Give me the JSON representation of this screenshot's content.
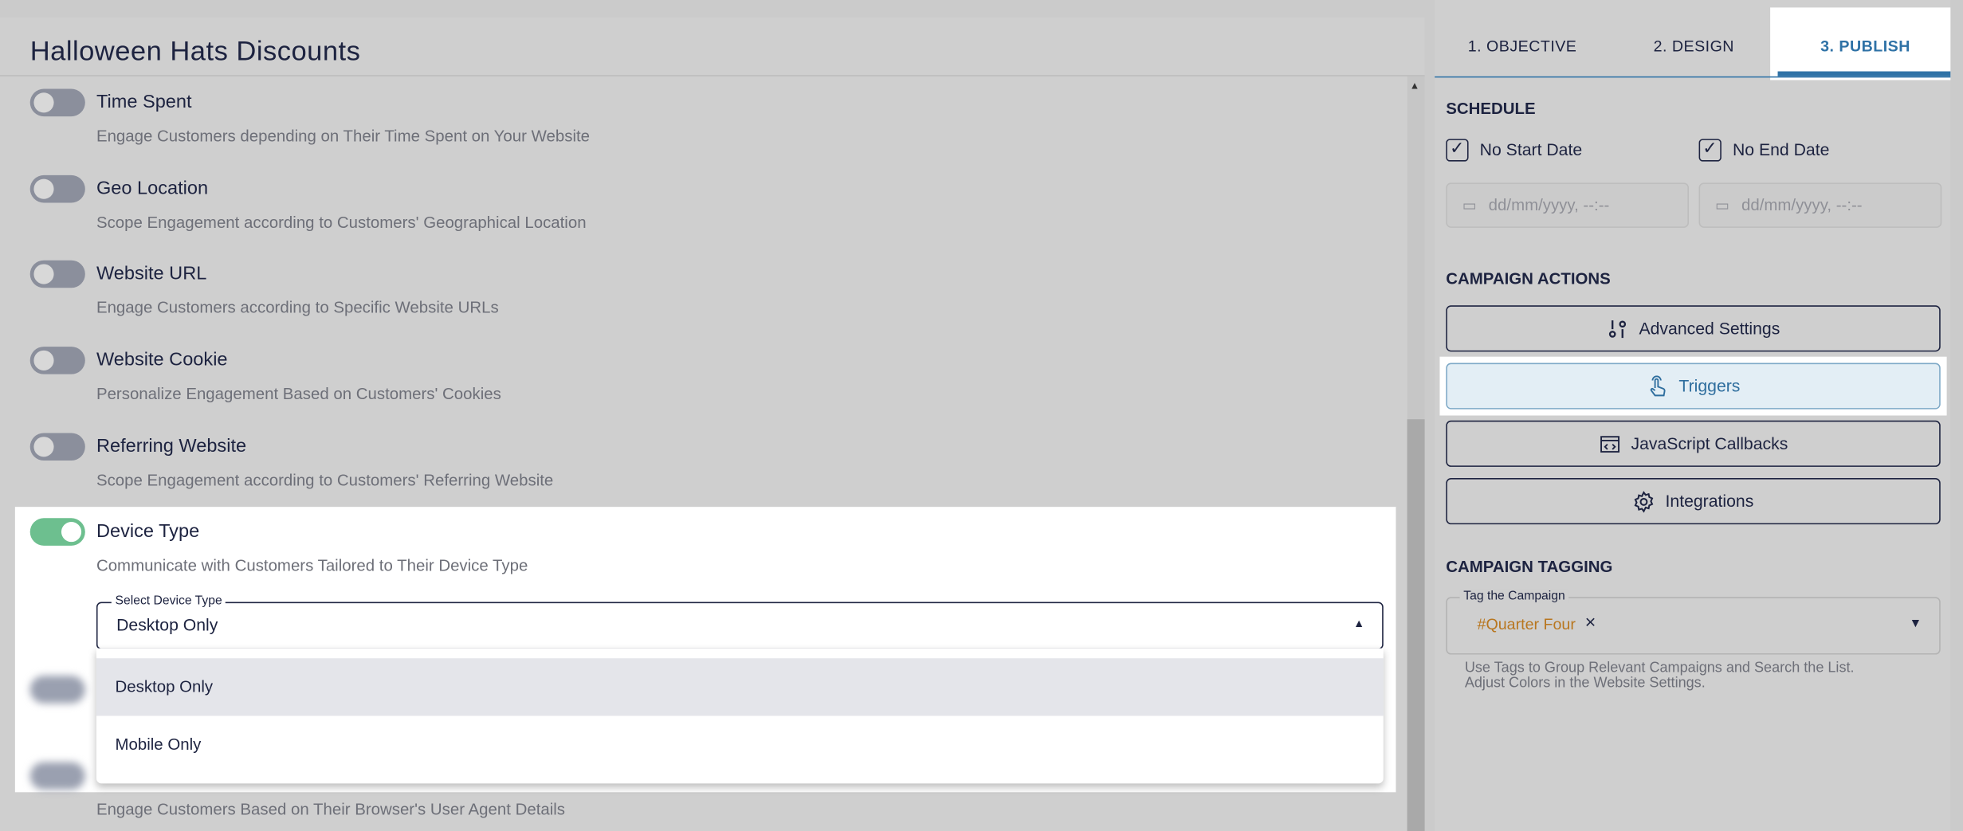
{
  "page_title": "Halloween Hats Discounts",
  "rules": [
    {
      "title": "Time Spent",
      "description": "Engage Customers depending on Their Time Spent on Your Website",
      "enabled": false
    },
    {
      "title": "Geo Location",
      "description": "Scope Engagement according to Customers' Geographical Location",
      "enabled": false
    },
    {
      "title": "Website URL",
      "description": "Engage Customers according to Specific Website URLs",
      "enabled": false
    },
    {
      "title": "Website Cookie",
      "description": "Personalize Engagement Based on Customers' Cookies",
      "enabled": false
    },
    {
      "title": "Referring Website",
      "description": "Scope Engagement according to Customers' Referring Website",
      "enabled": false
    },
    {
      "title": "Device Type",
      "description": "Communicate with Customers Tailored to Their Device Type",
      "enabled": true
    },
    {
      "description": "Engage Customers Based on Their Browser's User Agent Details",
      "enabled": false
    }
  ],
  "device_select": {
    "label": "Select Device Type",
    "value": "Desktop Only",
    "options": [
      "Desktop Only",
      "Mobile Only"
    ]
  },
  "tabs": [
    "1. OBJECTIVE",
    "2. DESIGN",
    "3. PUBLISH"
  ],
  "active_tab": "3. PUBLISH",
  "schedule": {
    "heading": "SCHEDULE",
    "no_start_label": "No Start Date",
    "no_end_label": "No End Date",
    "no_start_checked": true,
    "no_end_checked": true,
    "start_placeholder": "dd/mm/yyyy, --:--",
    "end_placeholder": "dd/mm/yyyy, --:--"
  },
  "actions": {
    "heading": "CAMPAIGN ACTIONS",
    "buttons": [
      {
        "label": "Advanced Settings",
        "icon": "sliders-icon"
      },
      {
        "label": "Triggers",
        "icon": "hand-pointer-icon"
      },
      {
        "label": "JavaScript Callbacks",
        "icon": "code-window-icon"
      },
      {
        "label": "Integrations",
        "icon": "gear-icon"
      }
    ]
  },
  "tagging": {
    "heading": "CAMPAIGN TAGGING",
    "field_label": "Tag the Campaign",
    "tags": [
      "#Quarter Four"
    ],
    "help_line1": "Use Tags to Group Relevant Campaigns and Search the List.",
    "help_line2": "Adjust Colors in the Website Settings."
  },
  "colors": {
    "accent": "#2f72a6",
    "toggle_on": "#6dbf8f",
    "tag": "#b8761f"
  }
}
